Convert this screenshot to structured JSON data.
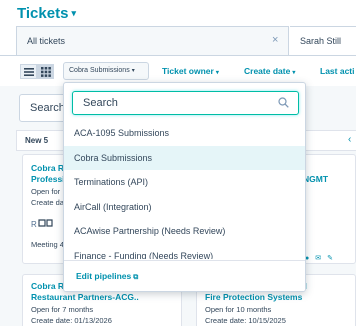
{
  "header": {
    "title": "Tickets",
    "title_caret": "▾"
  },
  "tabs": {
    "all": "All tickets",
    "close": "×",
    "sarah": "Sarah Still"
  },
  "filters": {
    "pipeline_pill": "Cobra Submissions",
    "ticket_owner": "Ticket owner",
    "create_date": "Create date",
    "last_activity": "Last acti",
    "caret": "▾"
  },
  "board": {
    "search_label": "Search",
    "column_new": "New  5",
    "chevron": "‹",
    "card1": {
      "title_line1": "Cobra R",
      "title_line2": "Professi",
      "open": "Open for",
      "created": "Create da",
      "meeting": "Meeting 4"
    },
    "card1b": {
      "title": "NGMT"
    },
    "card2": {
      "title_line1": "Cobra R",
      "title_line2": "Restaurant Partners-ACG..",
      "open": "Open for 7 months",
      "created": "Create date: 01/13/2026"
    },
    "card2b": {
      "title_line1": "ional",
      "title_line2": "Fire Protection Systems",
      "open": "Open for 10 months",
      "created": "Create date: 10/15/2025"
    }
  },
  "dropdown": {
    "search_placeholder": "Search",
    "items": [
      "ACA-1095 Submissions",
      "Cobra Submissions",
      "Terminations (API)",
      "AirCall (Integration)",
      "ACAwise Partnership (Needs Review)",
      "Finance - Funding (Needs Review)"
    ],
    "selected_index": 1,
    "edit_pipelines": "Edit pipelines"
  },
  "colors": {
    "accent": "#0091ae",
    "focus": "#00bda5",
    "selected_bg": "#e5f5f8",
    "text": "#33475b"
  }
}
